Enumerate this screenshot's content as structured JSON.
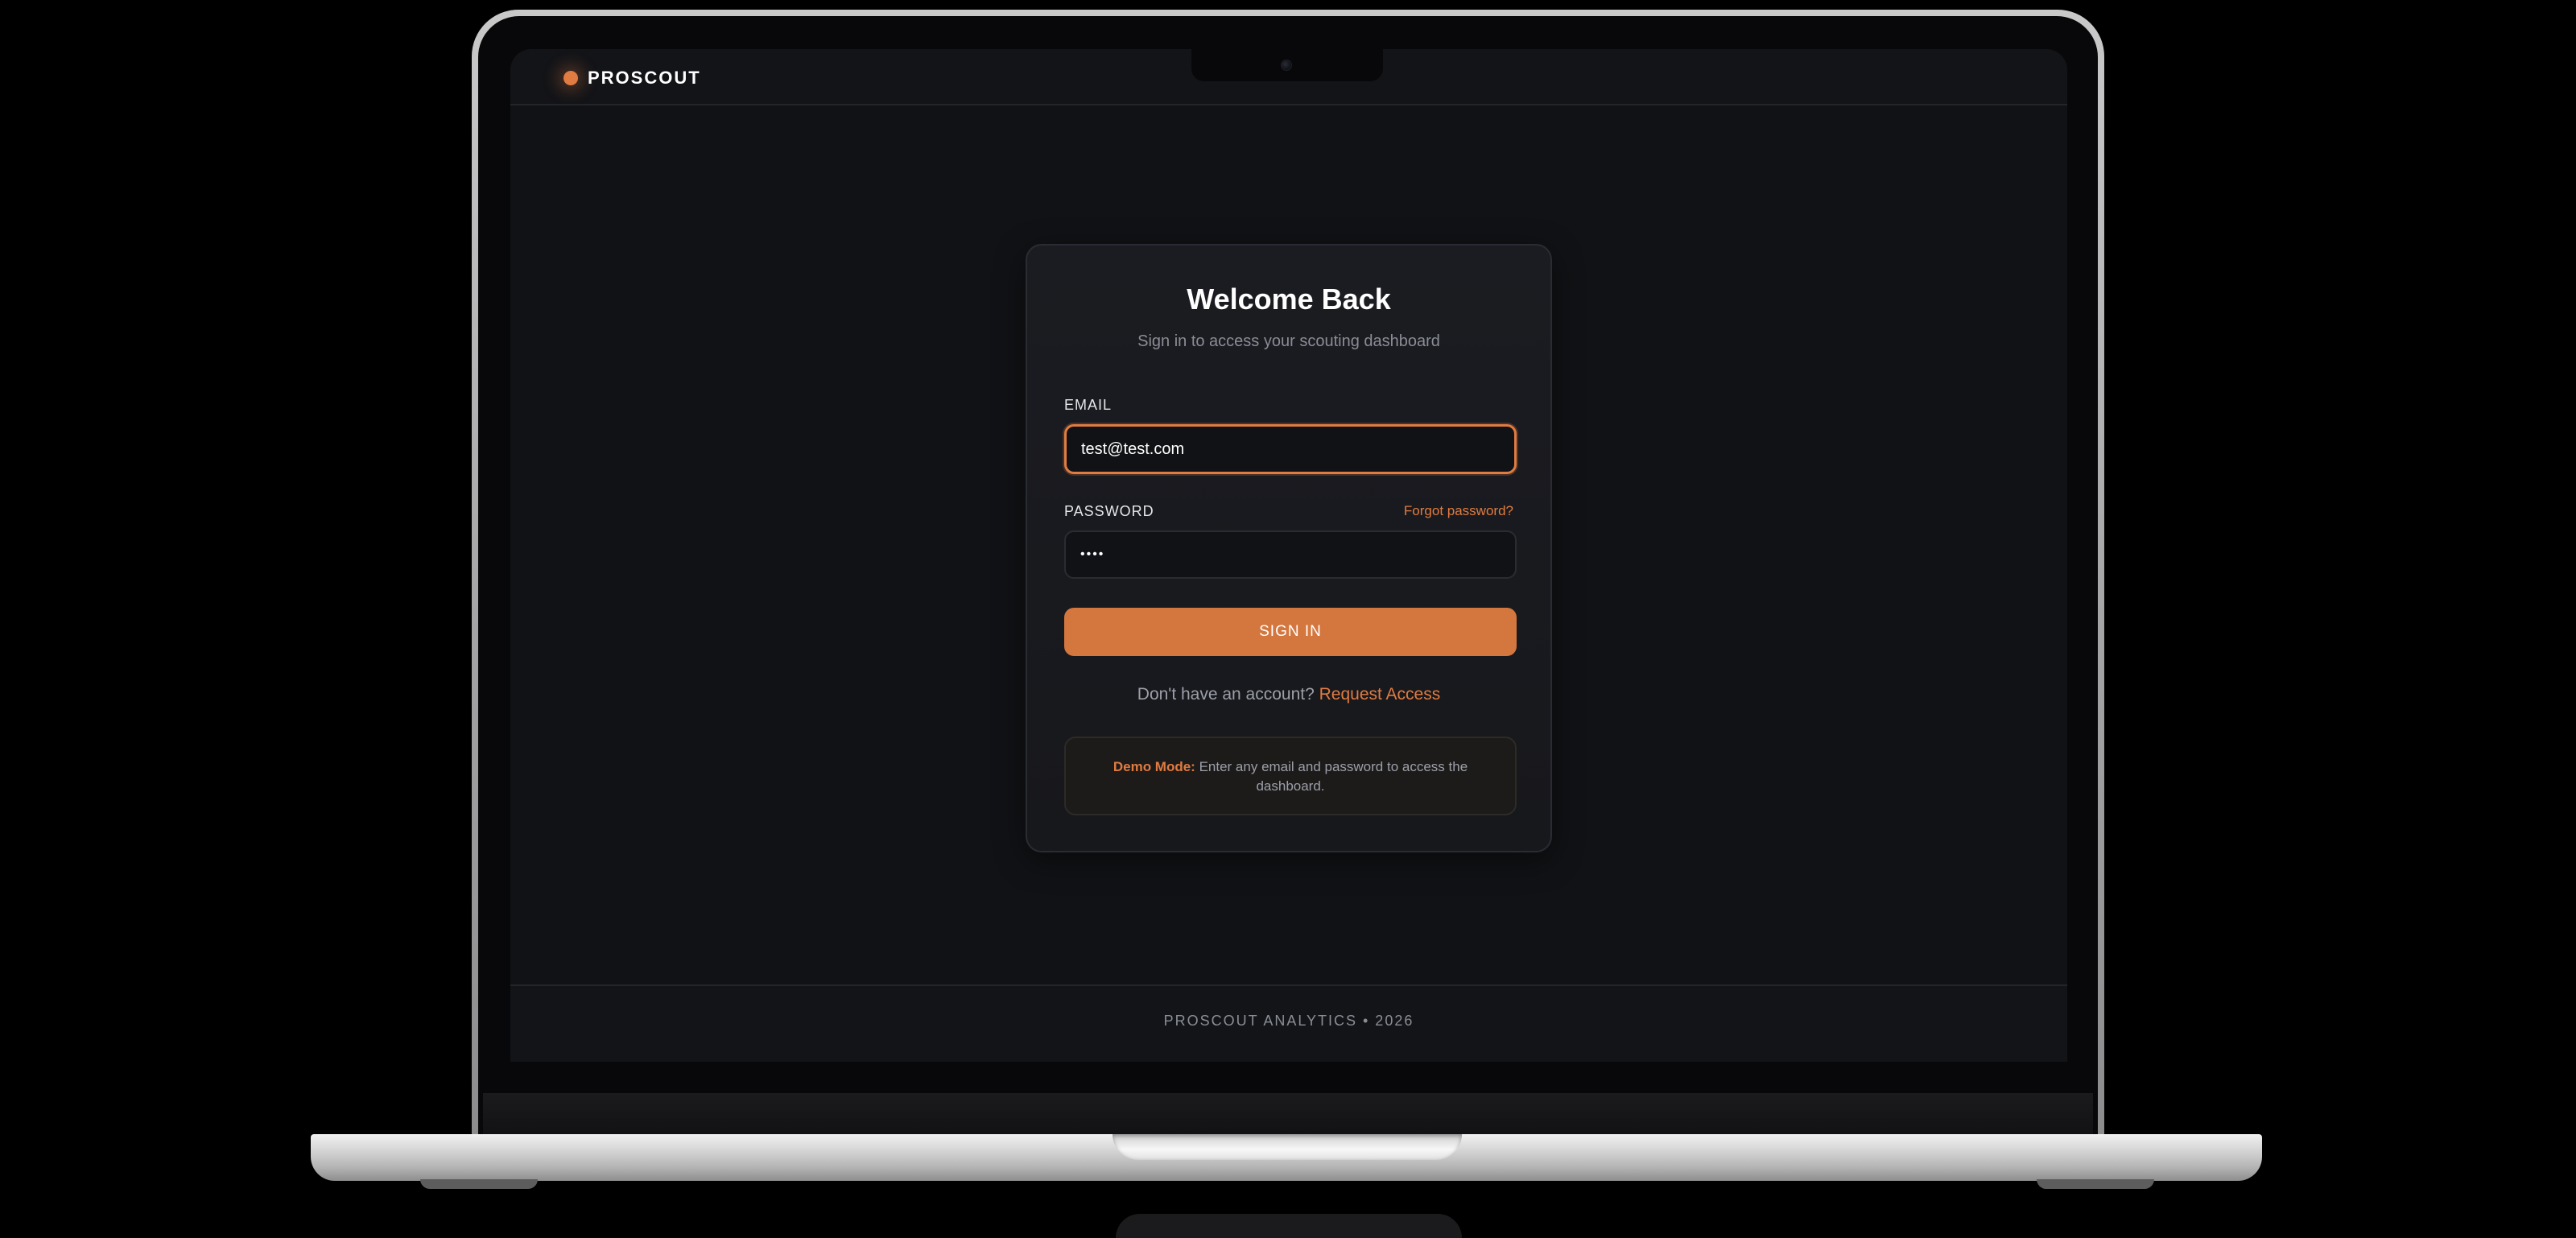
{
  "app": {
    "brand": "PROSCOUT",
    "accent_color": "#e07b41",
    "background_color": "#111215"
  },
  "login": {
    "title": "Welcome Back",
    "subtitle": "Sign in to access your scouting dashboard",
    "email_label": "EMAIL",
    "email_value": "test@test.com",
    "password_label": "PASSWORD",
    "password_value": "test",
    "forgot_password": "Forgot password?",
    "signin_button": "SIGN IN",
    "no_account_text": "Don't have an account?",
    "request_access": "Request Access",
    "demo_label": "Demo Mode:",
    "demo_text": "Enter any email and password to access the dashboard."
  },
  "footer": {
    "text": "PROSCOUT ANALYTICS • 2026"
  },
  "icons": {
    "brand": "brand-dot-icon",
    "camera": "camera-icon"
  }
}
